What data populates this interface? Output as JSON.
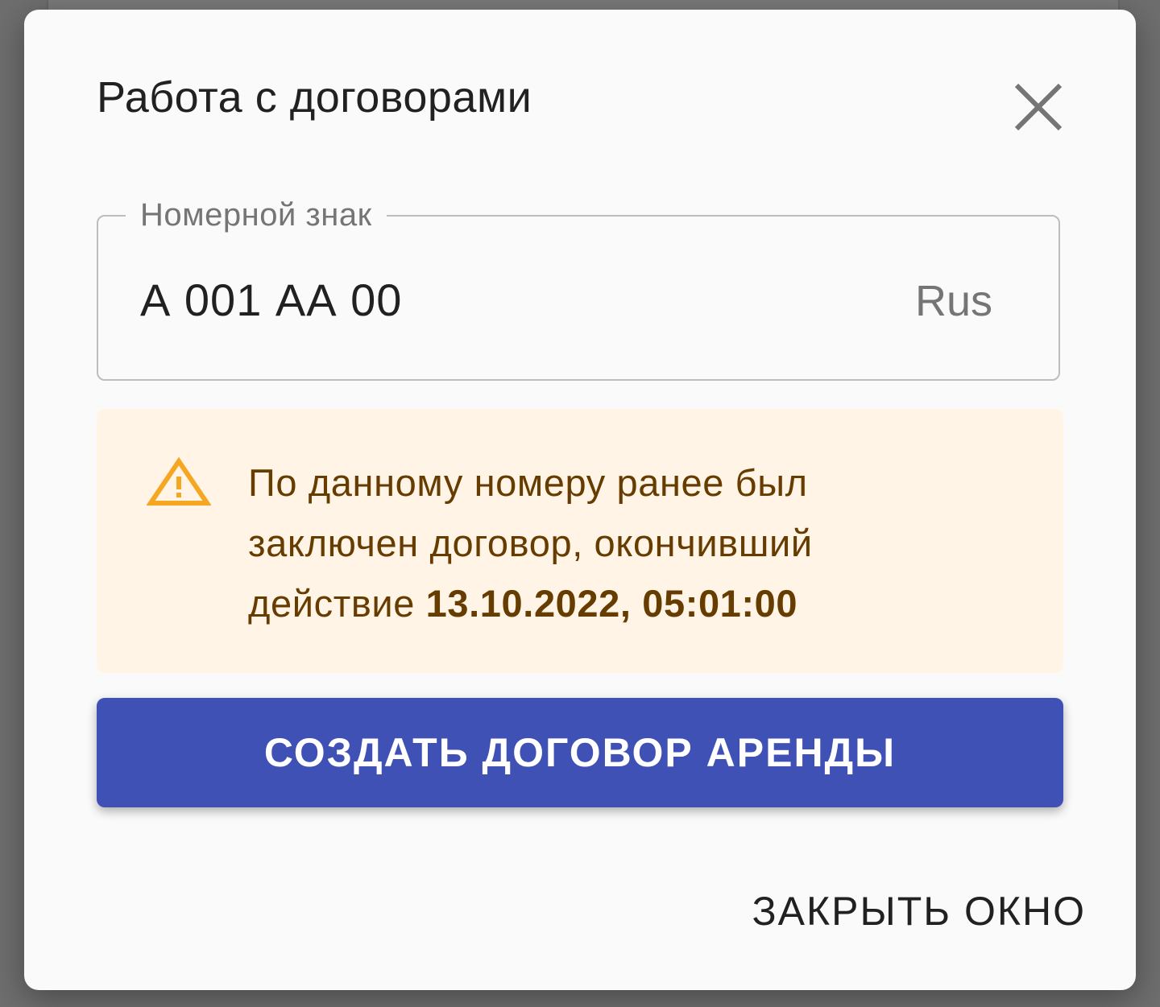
{
  "dialog": {
    "title": "Работа с договорами",
    "close_icon": "close-icon"
  },
  "plate_field": {
    "label": "Номерной знак",
    "value": "А 001 АА 00",
    "suffix": "Rus"
  },
  "alert": {
    "icon": "warning-icon",
    "text_prefix": "По данному номеру ранее был заключен договор, окончивший действие ",
    "text_bold": "13.10.2022, 05:01:00",
    "colors": {
      "background": "#fff4e5",
      "text": "#663c00",
      "icon": "#f5a623"
    }
  },
  "actions": {
    "create_label": "СОЗДАТЬ ДОГОВОР АРЕНДЫ",
    "close_label": "ЗАКРЫТЬ ОКНО",
    "primary_color": "#3f51b5"
  }
}
